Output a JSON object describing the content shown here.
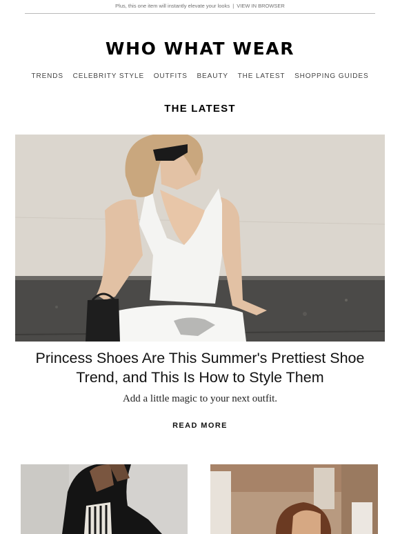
{
  "preheader": {
    "text": "Plus, this one item will instantly elevate your looks",
    "separator": "|",
    "link": "VIEW IN BROWSER"
  },
  "logo": "WHO WHAT WEAR",
  "nav": [
    "TRENDS",
    "CELEBRITY STYLE",
    "OUTFITS",
    "BEAUTY",
    "THE LATEST",
    "SHOPPING GUIDES"
  ],
  "section_title": "THE LATEST",
  "feature": {
    "image_icon": "hero-photo",
    "headline": "Princess Shoes Are This Summer's Prettiest Shoe Trend, and This Is How to Style Them",
    "dek": "Add a little magic to your next outfit.",
    "cta": "READ MORE"
  },
  "thumbnails": [
    {
      "image_icon": "thumbnail-photo"
    },
    {
      "image_icon": "thumbnail-photo"
    }
  ]
}
